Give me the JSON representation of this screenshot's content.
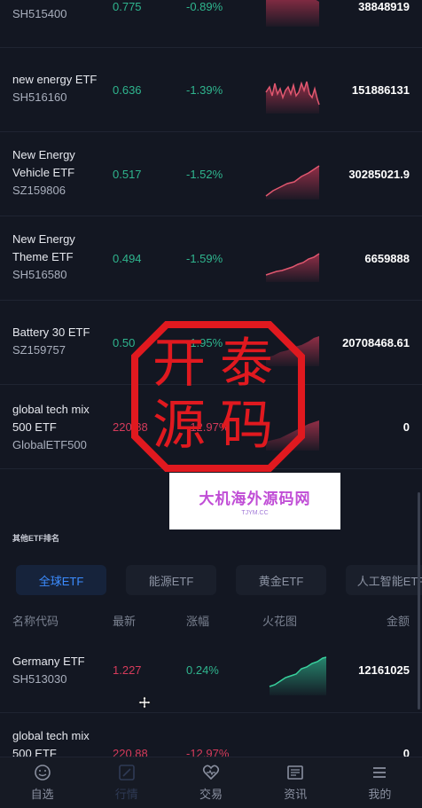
{
  "list_top": [
    {
      "name": "",
      "code": "SH515400",
      "price": "0.775",
      "change": "-0.89%",
      "amount": "38848919",
      "trend": "down"
    },
    {
      "name": "new energy ETF",
      "code": "SH516160",
      "price": "0.636",
      "change": "-1.39%",
      "amount": "151886131",
      "trend": "volatile"
    },
    {
      "name": "New Energy Vehicle ETF",
      "code": "SZ159806",
      "price": "0.517",
      "change": "-1.52%",
      "amount": "30285021.9",
      "trend": "up"
    },
    {
      "name": "New Energy Theme ETF",
      "code": "SH516580",
      "price": "0.494",
      "change": "-1.59%",
      "amount": "6659888",
      "trend": "up"
    },
    {
      "name": "Battery 30 ETF",
      "code": "SZ159757",
      "price": "0.50",
      "change": "-1.95%",
      "amount": "20708468.61",
      "trend": "up"
    },
    {
      "name": "global tech mix 500 ETF",
      "code": "GlobalETF500",
      "price": "220.88",
      "change": "-12.97%",
      "amount": "0",
      "trend": "up"
    }
  ],
  "section": {
    "title": "其他ETF排名",
    "tabs": [
      "全球ETF",
      "能源ETF",
      "黄金ETF",
      "人工智能ETF"
    ],
    "active_tab": 0,
    "columns": {
      "name": "名称代码",
      "price": "最新",
      "change": "涨幅",
      "spark": "火花图",
      "amount": "金额"
    }
  },
  "list_bottom": [
    {
      "name": "Germany ETF",
      "code": "SH513030",
      "price": "1.227",
      "change": "0.24%",
      "amount": "12161025"
    },
    {
      "name": "global tech mix 500 ETF",
      "price": "220.88",
      "change": "-12.97%",
      "amount": "0"
    }
  ],
  "watermark": {
    "stamp_chars": [
      "开",
      "泰",
      "源",
      "码"
    ],
    "banner_text": "大机海外源码网",
    "banner_sub": "TJYM.CC"
  },
  "nav": [
    {
      "label": "自选",
      "icon": "smile-icon"
    },
    {
      "label": "行情",
      "icon": "chart-icon"
    },
    {
      "label": "交易",
      "icon": "heart-icon"
    },
    {
      "label": "资讯",
      "icon": "news-icon"
    },
    {
      "label": "我的",
      "icon": "menu-icon"
    }
  ],
  "colors": {
    "background": "#131722",
    "up": "#2fb58e",
    "down": "#d63b5b",
    "accent": "#3c8cff"
  }
}
